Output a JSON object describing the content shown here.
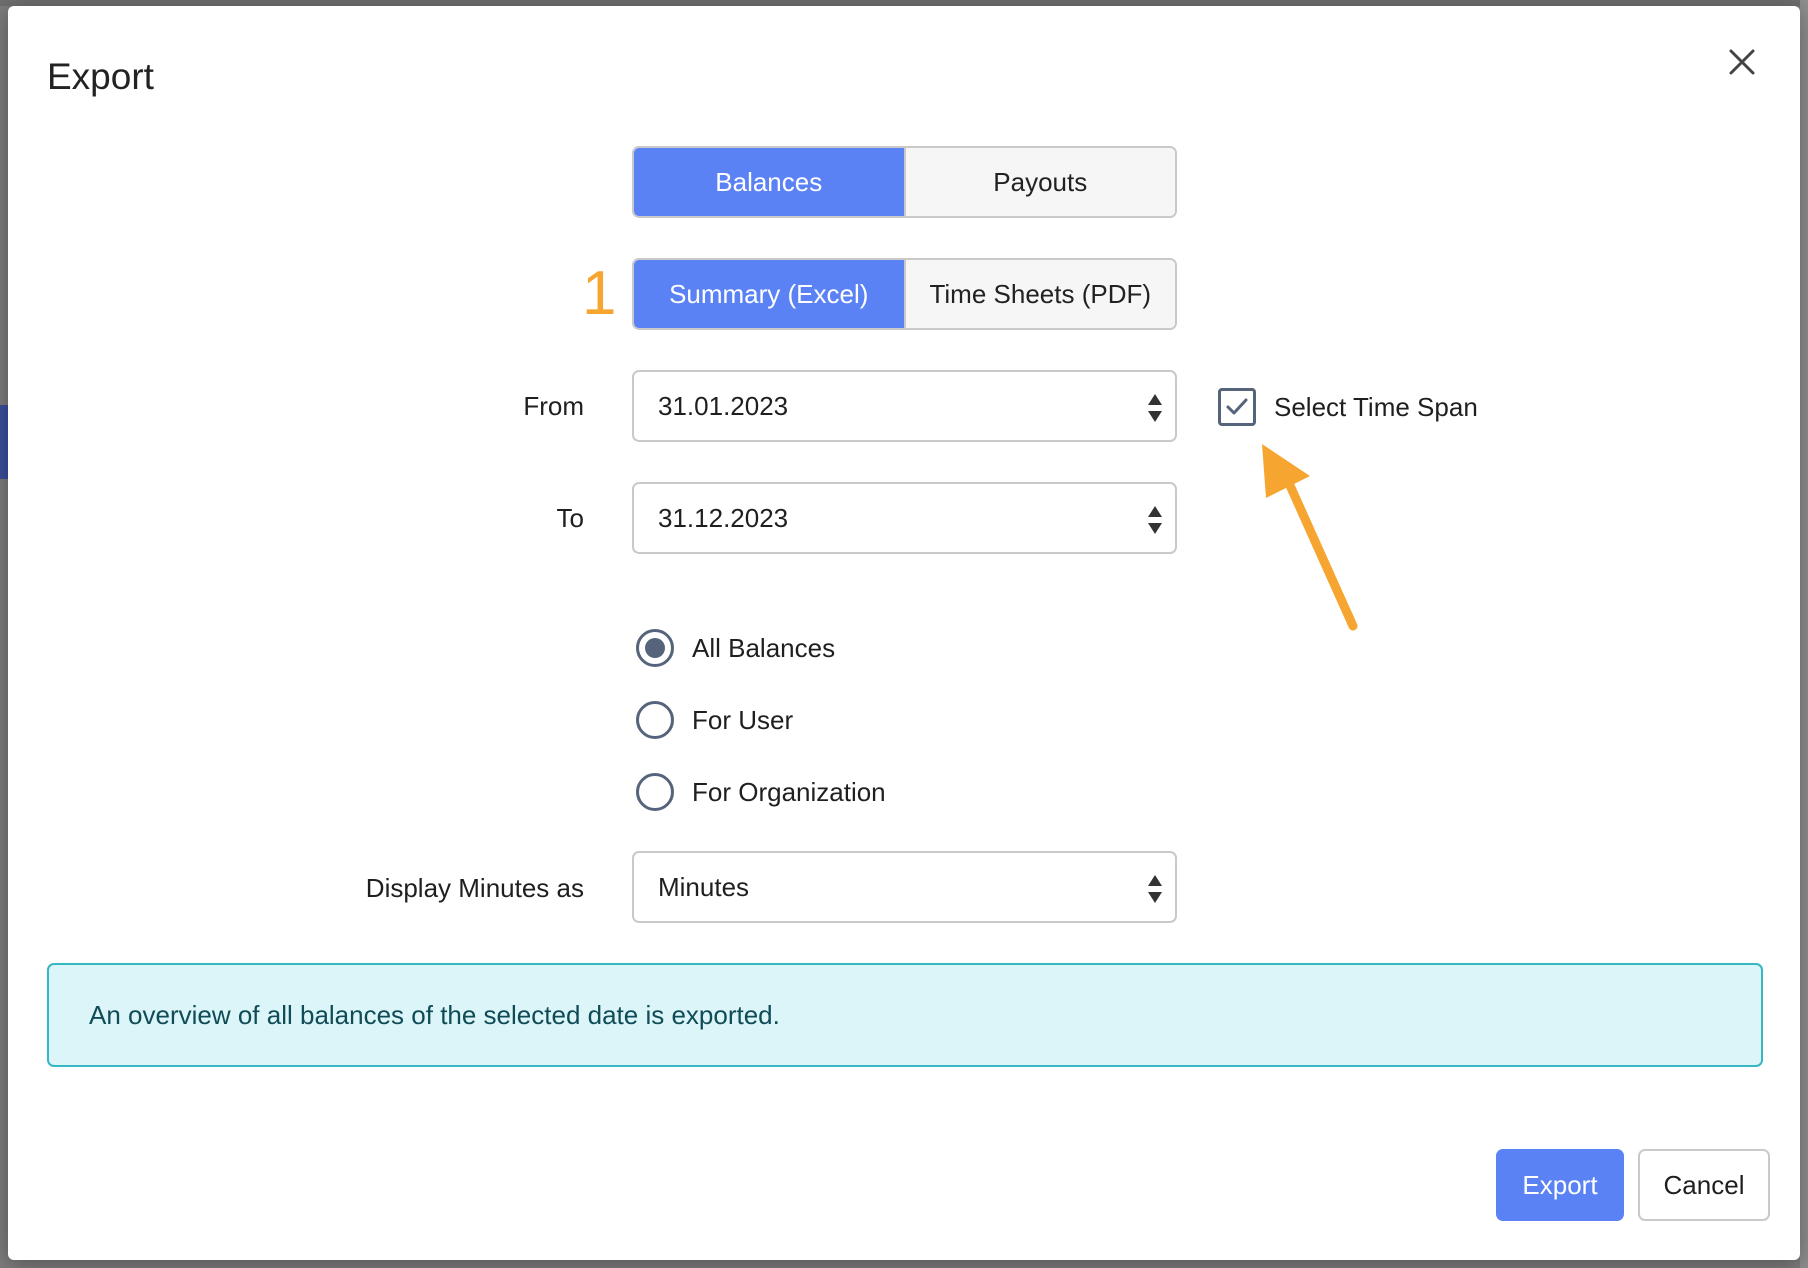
{
  "dialog": {
    "title": "Export",
    "close_icon": "close-icon"
  },
  "type_toggle": {
    "options": [
      {
        "label": "Balances",
        "active": true
      },
      {
        "label": "Payouts",
        "active": false
      }
    ]
  },
  "format_toggle": {
    "step_number": "1",
    "options": [
      {
        "label": "Summary (Excel)",
        "active": true
      },
      {
        "label": "Time Sheets (PDF)",
        "active": false
      }
    ]
  },
  "from": {
    "label": "From",
    "value": "31.01.2023"
  },
  "to": {
    "label": "To",
    "value": "31.12.2023"
  },
  "time_span": {
    "label": "Select Time Span",
    "checked": true
  },
  "scope": {
    "options": [
      {
        "label": "All Balances",
        "selected": true
      },
      {
        "label": "For User",
        "selected": false
      },
      {
        "label": "For Organization",
        "selected": false
      }
    ]
  },
  "display_minutes": {
    "label": "Display Minutes as",
    "value": "Minutes"
  },
  "info": {
    "text": "An overview of all balances of the selected date is exported."
  },
  "actions": {
    "export_label": "Export",
    "cancel_label": "Cancel"
  },
  "colors": {
    "primary": "#5b82f5",
    "annotation": "#f7a531",
    "info_bg": "#dcf5f8",
    "info_border": "#35b7c4"
  }
}
